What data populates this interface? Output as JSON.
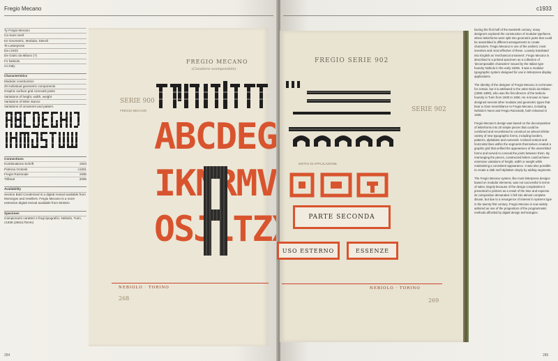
{
  "left_page": {
    "running_head": "Fregio Mecano",
    "page_number": "284",
    "meta_rows": [
      "Ty Fregio Mecano",
      "Ca Sans Serif",
      "Ke Geometric, Modular, Stencil",
      "Te Letterpress",
      "Da c1933",
      "De Giulio da Milano (?)",
      "Fo Nebiolo",
      "Co Italy"
    ],
    "characteristics_title": "Characteristics",
    "characteristics": [
      "Modular construction",
      "20 individual geometric components",
      "Graphic surface grid conceals joints",
      "Variations of height, width, weight",
      "Variations of letter stance",
      "Variations of ornament and pattern"
    ],
    "connections_title": "Connections",
    "connections": [
      {
        "name": "Kombinations-Schrift",
        "year": "1923"
      },
      {
        "name": "Patrona Grotesk",
        "year": "c1931"
      },
      {
        "name": "Fregio Razionale",
        "year": "1935"
      },
      {
        "name": "Trilbeat",
        "year": "2006"
      }
    ],
    "availability_title": "Availability",
    "availability": "Section Bold Condensed is a digital revival available from Monotype and resellers. Fregio Mecano is a more extensive digital revival available from Molotro",
    "specimen_title": "Specimen",
    "specimen": "Campionario caratteri e fregi tipografici. Nebiolo, Turin, c1936 (260x175mm)"
  },
  "specimen_left": {
    "title": "FREGIO MECANO",
    "subtitle": "(Carattere scomponibile)",
    "serie_label": "SERIE",
    "serie_number": "900",
    "side_label": "FREGIO MECANO",
    "row1": "ABCDEG",
    "row2": "IKNRMV",
    "row3": "OSJLTZX",
    "footer": "NEBIOLO · TORINO",
    "page": "268"
  },
  "right_page": {
    "running_head": "c1933",
    "page_number": "285",
    "paragraphs": [
      "During the first half of the twentieth century, many designers explored the construction of modular typefaces, where letterforms were split into geometric parts that could be assembled in different arrangements to create characters. Fregio Mecano is one of the earliest, most inventive and most effective of these. Loosely translated into English as 'mechanical ornament', Fregio Mecano is described in a printed specimen as a collection of 'decomposable characters' issued by the Italian type foundry Nebiolo in the early 1930s. It was a modular typographic system designed for use in letterpress display applications.",
      "The identity of the designer of Fregio Mecano is not known for certain, but it is attributed to the artist Giulio da Milano (1895–1990), who was the first director of the Nebiolo foundry in Turin from 1930 to 1936. He is known to have designed several other modular and geometric types that bear a close resemblance to Fregio Mecano, including Nebiolo's Neon and Fregio Razionale, both released in 1935.",
      "Fregio Mecano's design was based on the decomposition of letterforms into 20 simple pieces that could be combined and recombined to construct an almost infinite variety of new typographic forms, including borders, patterns, alphabets and numerals. Inclined vertical and horizontal lines within the segments themselves created a graphic grid that unified the appearance of the assembled forms and served to conceal the joints between them. By rearranging the pieces, constructed letters could achieve extensive variations of height, width or weight while maintaining a consistent appearance. It was also possible to create a slab serif alphabet simply by adding segments.",
      "The Fregio Mecano system, like most letterpress designs based on modular elements, was not successful in terms of sales, largely because of the design complexities it presented to printers as a result of the time and expense its composition demanded. It fell into almost complete disuse, but due to a resurgence of interest in systems type in the twenty-first century, Fregio Mecano is now widely admired as one of the progenitors of the programmatic methods afforded by digital design technologies."
    ]
  },
  "specimen_right": {
    "title": "FREGIO SERIE 902",
    "serie_label": "SERIE",
    "serie_number": "902",
    "motivi": "MOTIVI DI APPLICAZIONE",
    "box1": "PARTE SECONDA",
    "box2": "USO ESTERNO",
    "box3": "ESSENZE",
    "footer": "NEBIOLO · TORINO",
    "page": "269"
  },
  "colors": {
    "accent": "#d8542e",
    "paper": "#ece6d6",
    "ink": "#2c2a27"
  }
}
